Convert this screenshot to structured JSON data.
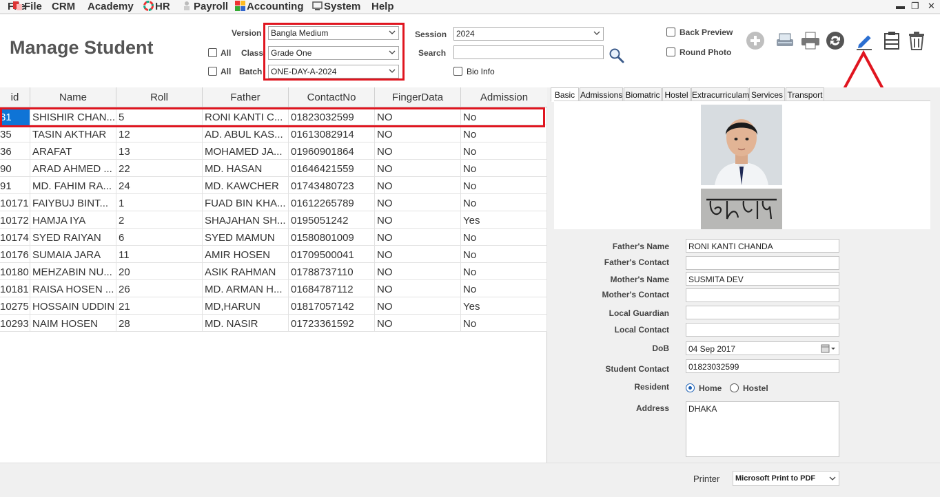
{
  "menu": {
    "file": "File",
    "crm": "CRM",
    "academy": "Academy",
    "hr": "HR",
    "payroll": "Payroll",
    "accounting": "Accounting",
    "system": "System",
    "help": "Help"
  },
  "window_controls": {
    "minimize": "▬",
    "restore": "❐",
    "close": "✕"
  },
  "page_title": "Manage Student",
  "filters": {
    "version_label": "Version",
    "version_value": "Bangla Medium",
    "class_label": "Class",
    "class_value": "Grade One",
    "batch_label": "Batch",
    "batch_value": "ONE-DAY-A-2024",
    "all_label": "All",
    "session_label": "Session",
    "session_value": "2024",
    "search_label": "Search",
    "search_value": "",
    "bio_info_label": "Bio Info",
    "back_preview_label": "Back Preview",
    "round_photo_label": "Round Photo"
  },
  "toolbar_icons": [
    "add-icon",
    "scanner-icon",
    "printer-icon",
    "refresh-icon",
    "edit-pencil-icon",
    "archive-icon",
    "trash-icon"
  ],
  "grid": {
    "headers": [
      "id",
      "Name",
      "Roll",
      "Father",
      "ContactNo",
      "FingerData",
      "Admission"
    ],
    "rows": [
      {
        "id": "31",
        "name": "SHISHIR CHAN...",
        "roll": "5",
        "father": "RONI KANTI C...",
        "contact": "01823032599",
        "finger": "NO",
        "admission": "No"
      },
      {
        "id": "35",
        "name": "TASIN AKTHAR",
        "roll": "12",
        "father": "AD. ABUL KAS...",
        "contact": "01613082914",
        "finger": "NO",
        "admission": "No"
      },
      {
        "id": "36",
        "name": "ARAFAT",
        "roll": "13",
        "father": "MOHAMED JA...",
        "contact": "01960901864",
        "finger": "NO",
        "admission": "No"
      },
      {
        "id": "90",
        "name": "ARAD AHMED ...",
        "roll": "22",
        "father": "MD. HASAN",
        "contact": "01646421559",
        "finger": "NO",
        "admission": "No"
      },
      {
        "id": "91",
        "name": "MD. FAHIM RA...",
        "roll": "24",
        "father": "MD. KAWCHER",
        "contact": "01743480723",
        "finger": "NO",
        "admission": "No"
      },
      {
        "id": "10171",
        "name": "FAIYBUJ BINT...",
        "roll": "1",
        "father": "FUAD BIN KHA...",
        "contact": "01612265789",
        "finger": "NO",
        "admission": "No"
      },
      {
        "id": "10172",
        "name": "HAMJA IYA",
        "roll": "2",
        "father": "SHAJAHAN SH...",
        "contact": "0195051242",
        "finger": "NO",
        "admission": "Yes"
      },
      {
        "id": "10174",
        "name": "SYED RAIYAN",
        "roll": "6",
        "father": "SYED MAMUN",
        "contact": "01580801009",
        "finger": "NO",
        "admission": "No"
      },
      {
        "id": "10176",
        "name": "SUMAIA JARA",
        "roll": "11",
        "father": "AMIR HOSEN",
        "contact": "01709500041",
        "finger": "NO",
        "admission": "No"
      },
      {
        "id": "10180",
        "name": "MEHZABIN NU...",
        "roll": "20",
        "father": "ASIK RAHMAN",
        "contact": "01788737110",
        "finger": "NO",
        "admission": "No"
      },
      {
        "id": "10181",
        "name": "RAISA HOSEN ...",
        "roll": "26",
        "father": "MD. ARMAN H...",
        "contact": "01684787112",
        "finger": "NO",
        "admission": "No"
      },
      {
        "id": "10275",
        "name": "HOSSAIN UDDIN",
        "roll": "21",
        "father": "MD,HARUN",
        "contact": "01817057142",
        "finger": "NO",
        "admission": "Yes"
      },
      {
        "id": "10293",
        "name": "NAIM HOSEN",
        "roll": "28",
        "father": "MD. NASIR",
        "contact": "01723361592",
        "finger": "NO",
        "admission": "No"
      }
    ]
  },
  "detail": {
    "tabs": [
      "Basic",
      "Admissions",
      "Biomatric",
      "Hostel",
      "Extracurriculam",
      "Services",
      "Transport"
    ],
    "fields": {
      "fathers_name_label": "Father's Name",
      "fathers_name": "RONI KANTI CHANDA",
      "fathers_contact_label": "Father's Contact",
      "fathers_contact": "",
      "mothers_name_label": "Mother's Name",
      "mothers_name": "SUSMITA DEV",
      "mothers_contact_label": "Mother's Contact",
      "mothers_contact": "",
      "local_guardian_label": "Local Guardian",
      "local_guardian": "",
      "local_contact_label": "Local Contact",
      "local_contact": "",
      "dob_label": "DoB",
      "dob": "04 Sep  2017",
      "student_contact_label": "Student Contact",
      "student_contact": "01823032599",
      "resident_label": "Resident",
      "resident_home": "Home",
      "resident_hostel": "Hostel",
      "resident_selected": "Home",
      "address_label": "Address",
      "address": "DHAKA"
    }
  },
  "footer": {
    "printer_label": "Printer",
    "printer_value": "Microsoft Print to PDF"
  },
  "colors": {
    "highlight_red": "#e0151f",
    "selection_blue": "#0f74d6"
  }
}
